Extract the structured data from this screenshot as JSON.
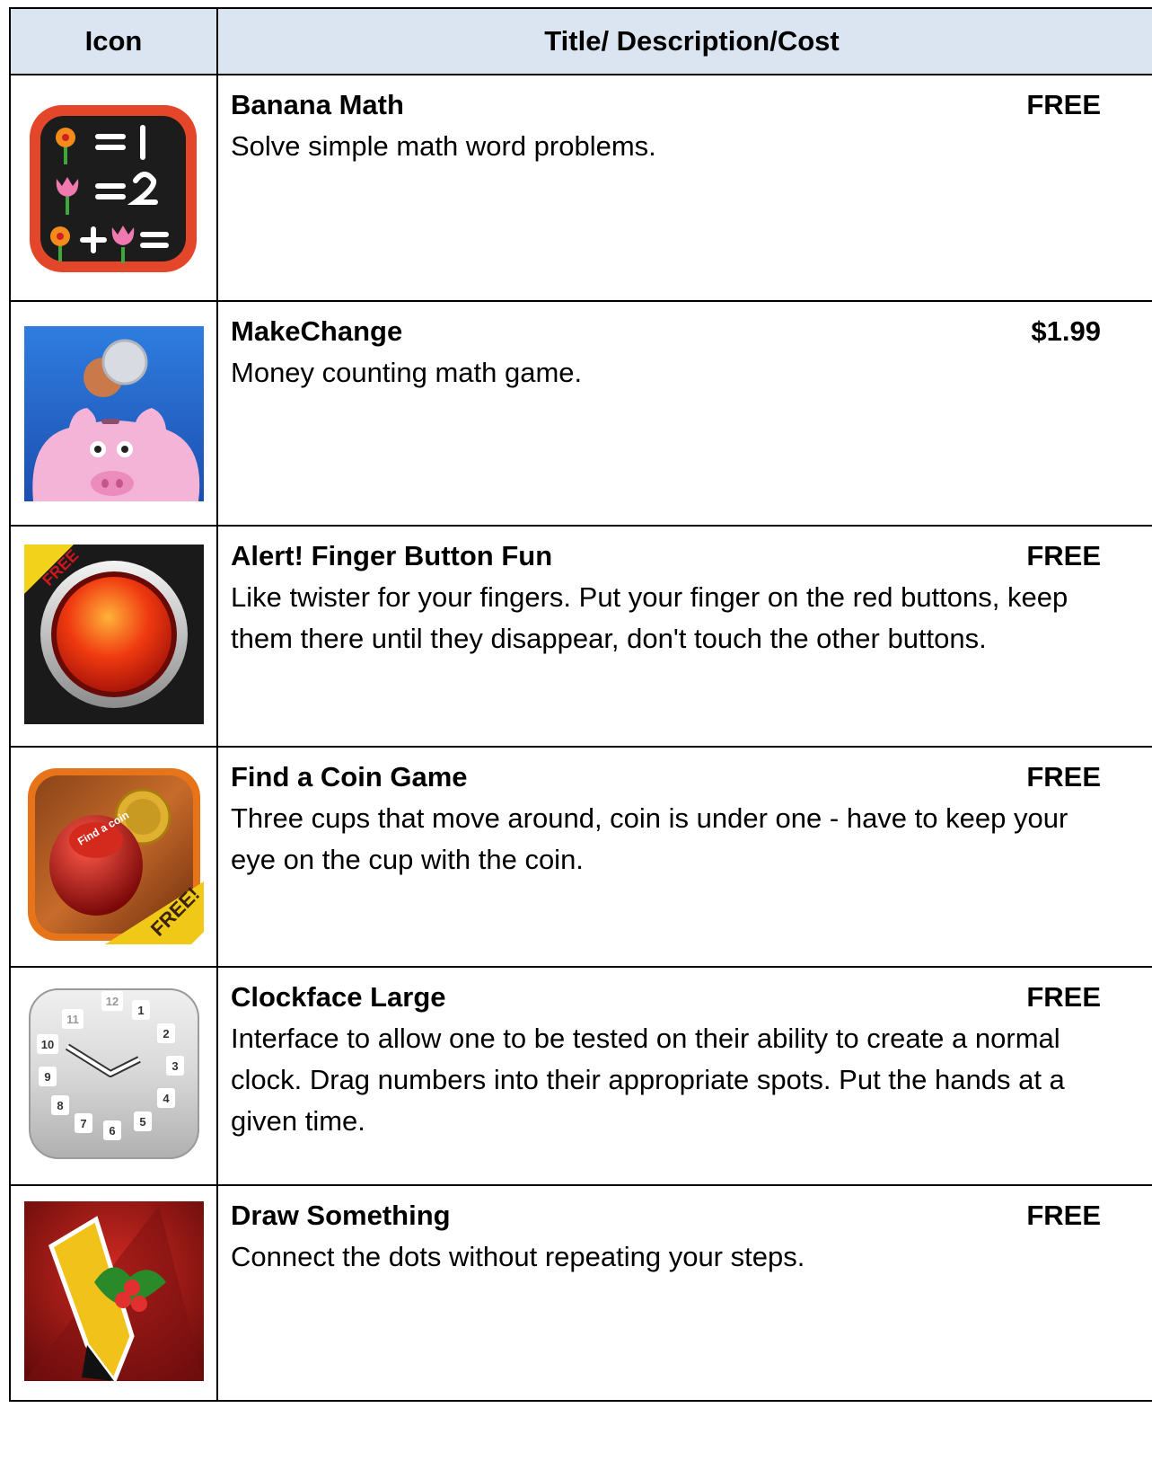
{
  "table": {
    "header_icon": "Icon",
    "header_desc": "Title/ Description/Cost",
    "rows": [
      {
        "title": "Banana Math",
        "cost": "FREE",
        "description": "Solve simple math word problems.",
        "icon": "flower-math-icon"
      },
      {
        "title": "MakeChange",
        "cost": "$1.99",
        "description": "Money counting math game.",
        "icon": "piggy-bank-icon"
      },
      {
        "title": "Alert! Finger Button Fun",
        "cost": "FREE",
        "description": "Like twister for your fingers.  Put your finger on the red buttons, keep them there until they disappear, don't touch the other buttons.",
        "icon": "red-button-icon",
        "badge": "FREE"
      },
      {
        "title": "Find a Coin Game",
        "cost": "FREE",
        "description": "Three cups that move around, coin is under one - have to keep your eye on the cup with the coin.",
        "icon": "cup-coin-icon",
        "badge": "FREE!",
        "cup_text": "Find a coin"
      },
      {
        "title": "Clockface Large",
        "cost": "FREE",
        "description": "Interface to allow one to be tested on their ability to create a normal clock.  Drag numbers into their appropriate spots.  Put the hands at a given time.",
        "icon": "clock-icon"
      },
      {
        "title": "Draw Something",
        "cost": "FREE",
        "description": "Connect the dots without repeating your steps.",
        "icon": "pencil-holly-icon"
      }
    ]
  }
}
